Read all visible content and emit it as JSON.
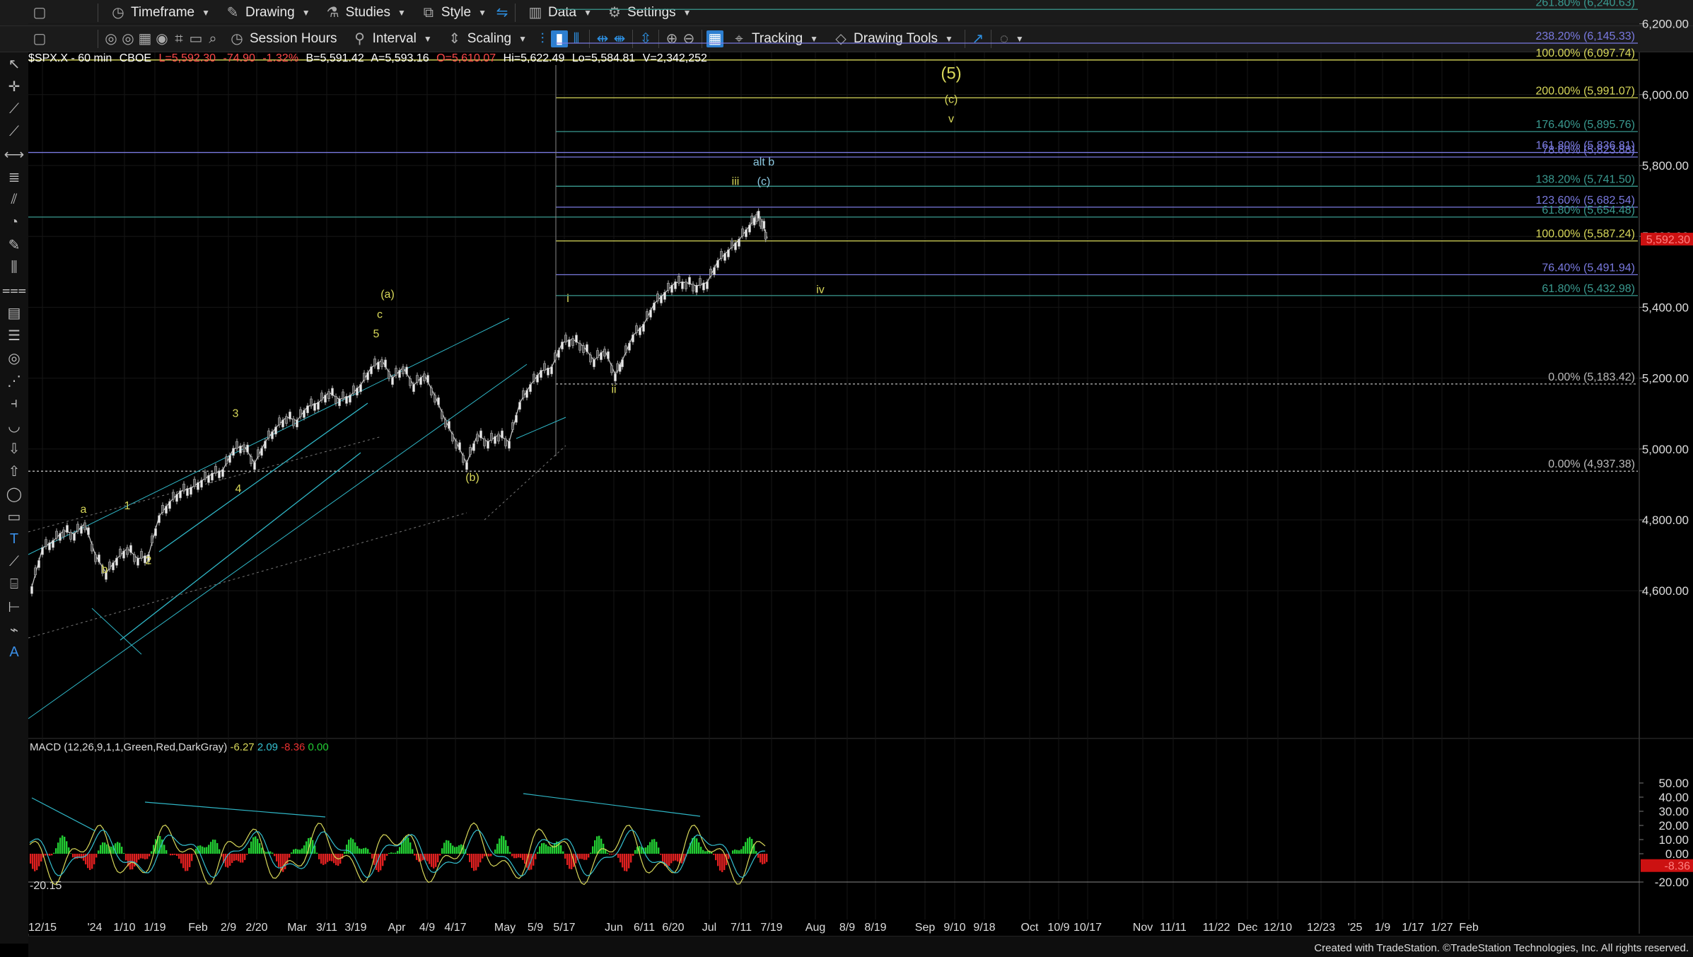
{
  "toolbar1": {
    "timeframe": "Timeframe",
    "drawing": "Drawing",
    "studies": "Studies",
    "style": "Style",
    "data": "Data",
    "settings": "Settings"
  },
  "toolbar2": {
    "session_hours": "Session Hours",
    "interval": "Interval",
    "scaling": "Scaling",
    "tracking": "Tracking",
    "drawing_tools": "Drawing Tools"
  },
  "header": {
    "symbol": "$SPX.X - 60 min",
    "exchange": "CBOE",
    "last": "L=5,592.30",
    "change": "-74.90",
    "change_pct": "-1.32%",
    "bid": "B=5,591.42",
    "ask": "A=5,593.16",
    "open": "O=5,610.07",
    "high": "Hi=5,622.49",
    "low": "Lo=5,584.81",
    "volume": "V=2,342,252"
  },
  "colors": {
    "yellow": "#d8d85a",
    "blue": "#4f8fd6",
    "cyan": "#2fb6c6",
    "teal": "#3a9a90",
    "green": "#22cc33",
    "red": "#e02020",
    "price_badge": "#cc1111"
  },
  "price_axis": [
    "6,200.00",
    "6,000.00",
    "5,800.00",
    "5,600.00",
    "5,400.00",
    "5,200.00",
    "5,000.00",
    "4,800.00",
    "4,600.00"
  ],
  "last_price_badge": "5,592.30",
  "fib_labels": [
    {
      "text": "261.80% (6,240.63)",
      "price": 6240.63,
      "color": "#3a9a90"
    },
    {
      "text": "238.20% (6,145.33)",
      "price": 6145.33,
      "color": "#7a7ae0"
    },
    {
      "text": "100.00% (6,097.74)",
      "price": 6097.74,
      "color": "#d8d85a"
    },
    {
      "text": "200.00% (5,991.07)",
      "price": 5991.07,
      "color": "#d8d85a"
    },
    {
      "text": "176.40% (5,895.76)",
      "price": 5895.76,
      "color": "#3a9a90"
    },
    {
      "text": "161.80% (5,836.81)",
      "price": 5836.81,
      "color": "#7a7ae0"
    },
    {
      "text": "78.60% (5,823.88)",
      "price": 5823.88,
      "color": "#7a7ae0"
    },
    {
      "text": "138.20% (5,741.50)",
      "price": 5741.5,
      "color": "#3a9a90"
    },
    {
      "text": "123.60% (5,682.54)",
      "price": 5682.54,
      "color": "#7a7ae0"
    },
    {
      "text": "61.80% (5,654.48)",
      "price": 5654.48,
      "color": "#3a9a90"
    },
    {
      "text": "100.00% (5,587.24)",
      "price": 5587.24,
      "color": "#d8d85a"
    },
    {
      "text": "76.40% (5,491.94)",
      "price": 5491.94,
      "color": "#7a7ae0"
    },
    {
      "text": "61.80% (5,432.98)",
      "price": 5432.98,
      "color": "#3a9a90"
    },
    {
      "text": "0.00% (5,183.42)",
      "price": 5183.42,
      "color": "#bbbbbb"
    },
    {
      "text": "0.00% (4,937.38)",
      "price": 4937.38,
      "color": "#bbbbbb"
    }
  ],
  "wave_labels": [
    {
      "text": "(5)",
      "price": 6045,
      "date": "9/10",
      "color": "#d8d85a",
      "big": true
    },
    {
      "text": "(c)",
      "price": 5977,
      "date": "9/10",
      "color": "#d8d85a"
    },
    {
      "text": "v",
      "price": 5922,
      "date": "9/10",
      "color": "#d8d85a"
    },
    {
      "text": "alt b",
      "price": 5800,
      "date": "7/16",
      "color": "#8cc8e0"
    },
    {
      "text": "(c)",
      "price": 5745,
      "date": "7/16",
      "color": "#8cc8e0"
    },
    {
      "text": "iii",
      "price": 5745,
      "date": "7/11",
      "color": "#d8d85a"
    },
    {
      "text": "iv",
      "price": 5440,
      "date": "7/31",
      "color": "#d8d85a"
    },
    {
      "text": "i",
      "price": 5415,
      "date": "5/18",
      "color": "#d8d85a"
    },
    {
      "text": "ii",
      "price": 5158,
      "date": "6/3",
      "color": "#d8d85a"
    },
    {
      "text": "(a)",
      "price": 5427,
      "date": "3/28",
      "color": "#d8d85a"
    },
    {
      "text": "c",
      "price": 5370,
      "date": "3/24",
      "color": "#d8d85a"
    },
    {
      "text": "5",
      "price": 5315,
      "date": "3/23",
      "color": "#d8d85a"
    },
    {
      "text": "3",
      "price": 5090,
      "date": "2/13",
      "color": "#d8d85a"
    },
    {
      "text": "4",
      "price": 4878,
      "date": "2/14",
      "color": "#d8d85a"
    },
    {
      "text": "(b)",
      "price": 4910,
      "date": "4/19",
      "color": "#d8d85a"
    },
    {
      "text": "a",
      "price": 4820,
      "date": "12/31",
      "color": "#d8d85a"
    },
    {
      "text": "1",
      "price": 4830,
      "date": "1/12",
      "color": "#d8d85a"
    },
    {
      "text": "2",
      "price": 4675,
      "date": "1/18",
      "color": "#d8d85a"
    },
    {
      "text": "b",
      "price": 4650,
      "date": "1/5",
      "color": "#d8d85a"
    }
  ],
  "date_axis": [
    "12/15",
    "'24",
    "1/10",
    "1/19",
    "Feb",
    "2/9",
    "2/20",
    "Mar",
    "3/11",
    "3/19",
    "Apr",
    "4/9",
    "4/17",
    "May",
    "5/9",
    "5/17",
    "Jun",
    "6/11",
    "6/20",
    "Jul",
    "7/11",
    "7/19",
    "Aug",
    "8/9",
    "8/19",
    "Sep",
    "9/10",
    "9/18",
    "Oct",
    "10/9",
    "10/17",
    "Nov",
    "11/11",
    "11/22",
    "Dec",
    "12/10",
    "12/23",
    "'25",
    "1/9",
    "1/17",
    "1/27",
    "Feb"
  ],
  "macd": {
    "title": "MACD (12,26,9,1,1,Green,Red,DarkGray)",
    "v1": "-6.27",
    "v2": "2.09",
    "v3": "-8.36",
    "v4": "0.00",
    "axis": [
      "50.00",
      "40.00",
      "30.00",
      "20.00",
      "10.00",
      "0.00",
      "-20.00"
    ],
    "low_label": "-20.15",
    "badge": "-8.36"
  },
  "footer": "Created with TradeStation. ©TradeStation Technologies, Inc. All rights reserved."
}
